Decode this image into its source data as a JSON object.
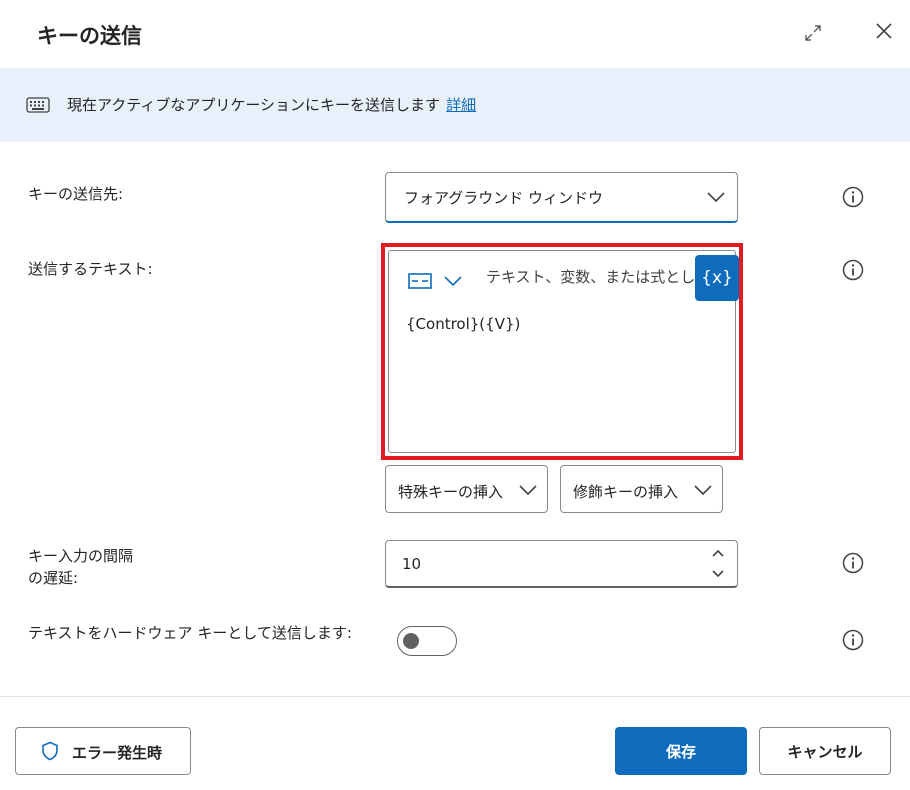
{
  "dialog": {
    "title": "キーの送信",
    "expand_icon": "expand-icon",
    "close_icon": "close-icon"
  },
  "banner": {
    "icon": "keyboard-icon",
    "text": "現在アクティブなアプリケーションにキーを送信します",
    "link": "詳細"
  },
  "fields": {
    "target": {
      "label": "キーの送信先:",
      "value": "フォアグラウンド ウィンドウ"
    },
    "text": {
      "label": "送信するテキスト:",
      "placeholder": "テキスト、変数、または式として",
      "var_button": "{x}",
      "value": "{Control}({V})"
    },
    "special_keys": {
      "label": "特殊キーの挿入"
    },
    "modifier_keys": {
      "label": "修飾キーの挿入"
    },
    "delay": {
      "label_line1": "キー入力の間隔",
      "label_line2": "の遅延:",
      "value": "10"
    },
    "hardware": {
      "label": "テキストをハードウェア キーとして送信します:",
      "toggle_on": false
    }
  },
  "footer": {
    "error_button": "エラー発生時",
    "save_button": "保存",
    "cancel_button": "キャンセル"
  },
  "colors": {
    "accent": "#0f6cbd",
    "highlight": "#e01b24",
    "banner_bg": "#e8f1fb"
  }
}
